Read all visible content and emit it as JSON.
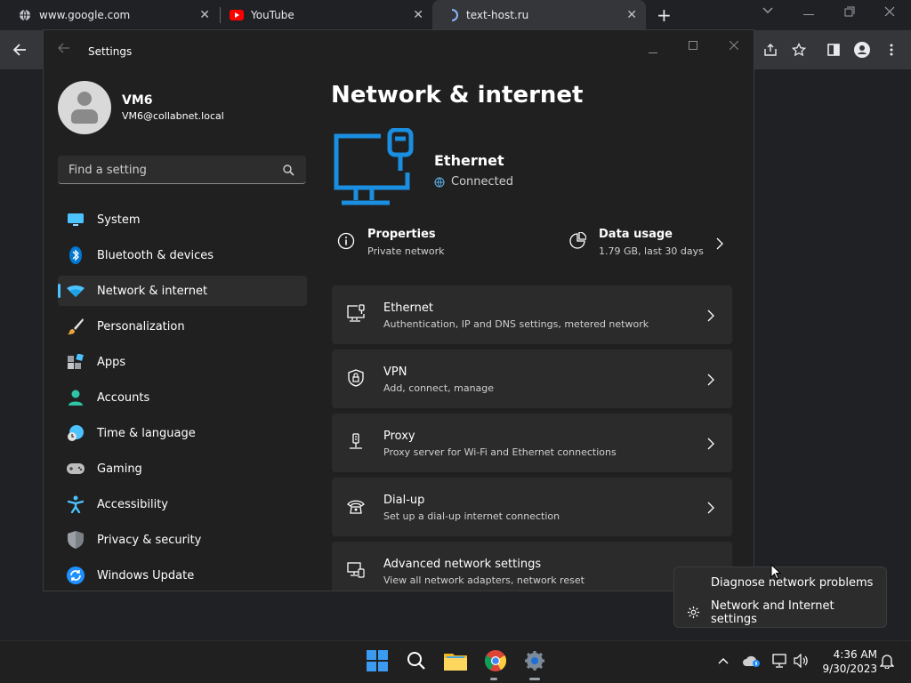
{
  "browser": {
    "tabs": [
      {
        "title": "www.google.com",
        "icon": "globe-icon"
      },
      {
        "title": "YouTube",
        "icon": "youtube-icon"
      },
      {
        "title": "text-host.ru",
        "icon": "loading-icon"
      }
    ],
    "new_tab": "+",
    "close_glyph": "✕"
  },
  "settings": {
    "window_title": "Settings",
    "user": {
      "name": "VM6",
      "email": "VM6@collabnet.local"
    },
    "search_placeholder": "Find a setting",
    "nav": [
      {
        "label": "System",
        "icon": "monitor-icon",
        "color": "#4cc2ff"
      },
      {
        "label": "Bluetooth & devices",
        "icon": "bluetooth-icon",
        "color": "#0078d4"
      },
      {
        "label": "Network & internet",
        "icon": "wifi-icon",
        "color": "#4cc2ff",
        "active": true
      },
      {
        "label": "Personalization",
        "icon": "brush-icon",
        "color": "#e8a33d"
      },
      {
        "label": "Apps",
        "icon": "apps-icon",
        "color": "#9aa0a6"
      },
      {
        "label": "Accounts",
        "icon": "person-icon",
        "color": "#2ec4a5"
      },
      {
        "label": "Time & language",
        "icon": "clock-globe-icon",
        "color": "#4cc2ff"
      },
      {
        "label": "Gaming",
        "icon": "gamepad-icon",
        "color": "#bdbdbd"
      },
      {
        "label": "Accessibility",
        "icon": "accessibility-icon",
        "color": "#4cc2ff"
      },
      {
        "label": "Privacy & security",
        "icon": "shield-icon",
        "color": "#9aa0a6"
      },
      {
        "label": "Windows Update",
        "icon": "update-icon",
        "color": "#1e90ff"
      }
    ],
    "page_title": "Network & internet",
    "hero": {
      "name": "Ethernet",
      "status": "Connected"
    },
    "properties": {
      "title": "Properties",
      "subtitle": "Private network"
    },
    "data_usage": {
      "title": "Data usage",
      "subtitle": "1.79 GB, last 30 days"
    },
    "cards": [
      {
        "title": "Ethernet",
        "subtitle": "Authentication, IP and DNS settings, metered network",
        "icon": "ethernet-icon"
      },
      {
        "title": "VPN",
        "subtitle": "Add, connect, manage",
        "icon": "vpn-shield-icon"
      },
      {
        "title": "Proxy",
        "subtitle": "Proxy server for Wi-Fi and Ethernet connections",
        "icon": "proxy-icon"
      },
      {
        "title": "Dial-up",
        "subtitle": "Set up a dial-up internet connection",
        "icon": "dialup-icon"
      },
      {
        "title": "Advanced network settings",
        "subtitle": "View all network adapters, network reset",
        "icon": "advanced-network-icon"
      }
    ]
  },
  "context_menu": {
    "items": [
      {
        "label": "Diagnose network problems"
      },
      {
        "label": "Network and Internet settings",
        "icon": "gear-icon"
      }
    ]
  },
  "taskbar": {
    "time": "4:36 AM",
    "date": "9/30/2023"
  }
}
